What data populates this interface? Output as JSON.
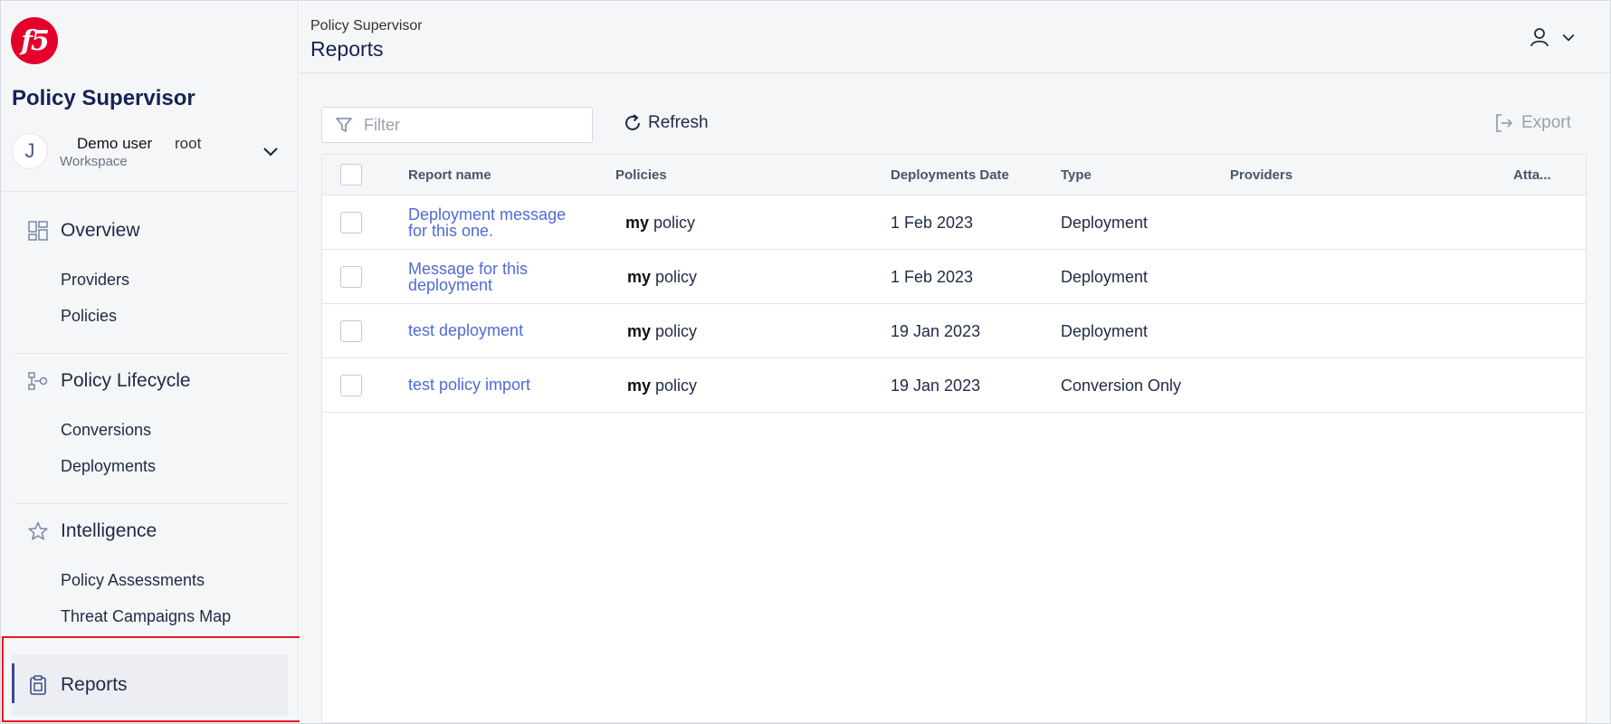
{
  "sidebar": {
    "logo_text": "f5",
    "app_name": "Policy Supervisor",
    "user": {
      "initial": "J",
      "name": "Demo user",
      "root": "root",
      "workspace_label": "Workspace"
    },
    "sections": [
      {
        "label": "Overview",
        "icon": "dashboard-icon",
        "items": [
          "Providers",
          "Policies"
        ]
      },
      {
        "label": "Policy Lifecycle",
        "icon": "lifecycle-icon",
        "items": [
          "Conversions",
          "Deployments"
        ]
      },
      {
        "label": "Intelligence",
        "icon": "star-icon",
        "items": [
          "Policy Assessments",
          "Threat Campaigns Map"
        ]
      }
    ],
    "active": {
      "label": "Reports",
      "icon": "clipboard-icon"
    },
    "highlight_color": "#e31b23"
  },
  "header": {
    "breadcrumb": "Policy Supervisor",
    "title": "Reports"
  },
  "toolbar": {
    "filter_placeholder": "Filter",
    "refresh_label": "Refresh",
    "export_label": "Export"
  },
  "table": {
    "columns": [
      "Report name",
      "Policies",
      "Deployments Date",
      "Type",
      "Providers",
      "Atta..."
    ],
    "rows": [
      {
        "name": "Deployment message for this one.",
        "policy_prefix": "my",
        "policy": "policy",
        "date": "1 Feb 2023",
        "type": "Deployment",
        "providers": "",
        "attached": ""
      },
      {
        "name": "Message for this deployment",
        "policy_prefix": "my",
        "policy": "policy",
        "date": "1 Feb 2023",
        "type": "Deployment",
        "providers": "",
        "attached": ""
      },
      {
        "name": "test deployment",
        "policy_prefix": "my",
        "policy": "policy",
        "date": "19 Jan 2023",
        "type": "Deployment",
        "providers": "",
        "attached": ""
      },
      {
        "name": "test policy import",
        "policy_prefix": "my",
        "policy": "policy",
        "date": "19 Jan 2023",
        "type": "Conversion Only",
        "providers": "",
        "attached": ""
      }
    ]
  },
  "colors": {
    "link": "#4f6bd8",
    "brand_red": "#e4002b",
    "text_dark": "#152354"
  }
}
